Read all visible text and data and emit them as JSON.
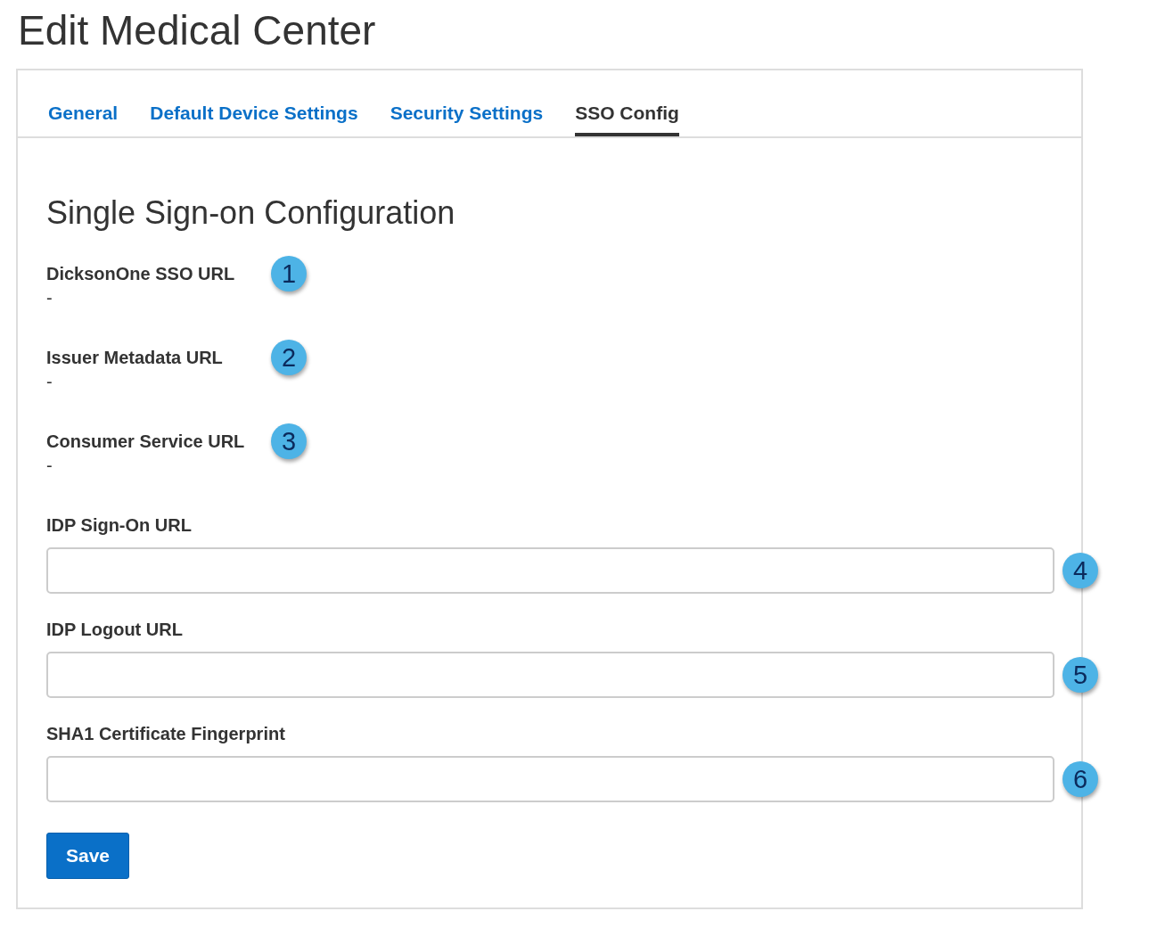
{
  "page": {
    "title": "Edit Medical Center"
  },
  "tabs": [
    {
      "label": "General",
      "selected": false
    },
    {
      "label": "Default Device Settings",
      "selected": false
    },
    {
      "label": "Security Settings",
      "selected": false
    },
    {
      "label": "SSO Config",
      "selected": true
    }
  ],
  "section": {
    "heading": "Single Sign-on Configuration"
  },
  "fields": [
    {
      "kind": "display",
      "label": "DicksonOne SSO URL",
      "value": "-",
      "callout": "1"
    },
    {
      "kind": "display",
      "label": "Issuer Metadata URL",
      "value": "-",
      "callout": "2"
    },
    {
      "kind": "display",
      "label": "Consumer Service URL",
      "value": "-",
      "callout": "3"
    },
    {
      "kind": "input",
      "label": "IDP Sign-On URL",
      "callout": "4"
    },
    {
      "kind": "input",
      "label": "IDP Logout URL",
      "callout": "5"
    },
    {
      "kind": "input",
      "label": "SHA1 Certificate Fingerprint",
      "callout": "6"
    }
  ],
  "buttons": [
    {
      "label": "Save"
    }
  ]
}
